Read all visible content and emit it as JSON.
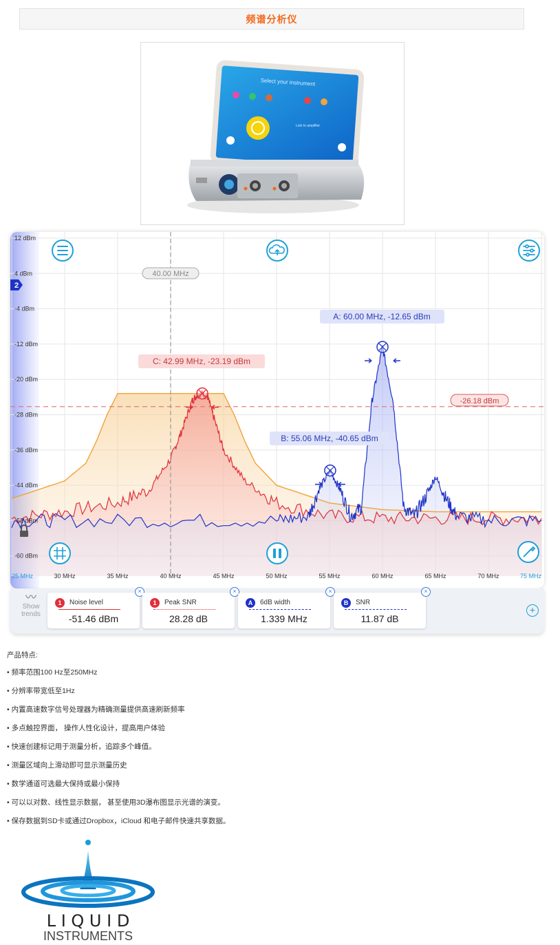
{
  "page_title": "频谱分析仪",
  "product_screen": {
    "heading": "Select your instrument",
    "center_label": "Link to amplifier"
  },
  "analyzer": {
    "y_ticks": [
      "12 dBm",
      "4 dBm",
      "-4 dBm",
      "-12 dBm",
      "-20 dBm",
      "-28 dBm",
      "-36 dBm",
      "-44 dBm",
      "-52 dBm",
      "-60 dBm"
    ],
    "x_ticks": [
      "25 MHz",
      "30 MHz",
      "35 MHz",
      "40 MHz",
      "45 MHz",
      "50 MHz",
      "55 MHz",
      "60 MHz",
      "65 MHz",
      "70 MHz",
      "75 MHz"
    ],
    "cursor_label": "40.00 MHz",
    "threshold_label": "-26.18 dBm",
    "channel_badge": "2",
    "markers": {
      "A": "A: 60.00 MHz, -12.65 dBm",
      "B": "B: 55.06 MHz, -40.65 dBm",
      "C": "C: 42.99 MHz, -23.19 dBm"
    },
    "colors": {
      "red": "#e0303a",
      "blue": "#1f33c6",
      "orange": "#f0a33a",
      "accent": "#1ea0d8"
    }
  },
  "chart_data": {
    "type": "line",
    "xlabel": "",
    "ylabel": "",
    "xlim": [
      25,
      75
    ],
    "ylim": [
      -64,
      12
    ],
    "x_ticks": [
      25,
      30,
      35,
      40,
      45,
      50,
      55,
      60,
      65,
      70,
      75
    ],
    "y_ticks": [
      12,
      4,
      -4,
      -12,
      -20,
      -28,
      -36,
      -44,
      -52,
      -60
    ],
    "series": [
      {
        "color": "#e0303a",
        "x": [
          25,
          30,
          35,
          38,
          40,
          41,
          42,
          42.5,
          42.99,
          43.5,
          44,
          45,
          47,
          50,
          55,
          60,
          65,
          70,
          75
        ],
        "y": [
          -51.5,
          -50,
          -48,
          -45,
          -38,
          -32,
          -25,
          -23.5,
          -23.19,
          -24,
          -28,
          -36,
          -43,
          -48,
          -51,
          -51.5,
          -51.5,
          -51.5,
          -51.5
        ]
      },
      {
        "color": "#1f33c6",
        "x": [
          25,
          30,
          40,
          50,
          53,
          54,
          55.06,
          56,
          57,
          58,
          59,
          60,
          61,
          62,
          63,
          64,
          65,
          66,
          67,
          70,
          75
        ],
        "y": [
          -52,
          -52,
          -52,
          -52,
          -51,
          -45,
          -40.65,
          -45,
          -51,
          -49,
          -25,
          -12.65,
          -25,
          -49,
          -51,
          -47,
          -42,
          -47,
          -51,
          -52,
          -52
        ]
      },
      {
        "color": "#f0a33a",
        "x": [
          25,
          30,
          32,
          33,
          34,
          35,
          36,
          37,
          38,
          40,
          42,
          43,
          44,
          45,
          46,
          47,
          48,
          50,
          55,
          60,
          65,
          70,
          75
        ],
        "y": [
          -47,
          -43,
          -39,
          -34,
          -28,
          -23.2,
          -23.2,
          -23.2,
          -23.2,
          -23.2,
          -23.2,
          -23.2,
          -23.2,
          -23.2,
          -28,
          -34,
          -39,
          -44,
          -48,
          -49.5,
          -50,
          -50,
          -50
        ]
      }
    ]
  },
  "measurements": {
    "show_trends": "Show trends",
    "cards": [
      {
        "badge": "1",
        "label": "Noise level",
        "value": "-51.46 dBm",
        "color": "#e0303a"
      },
      {
        "badge": "1",
        "label": "Peak SNR",
        "value": "28.28 dB",
        "color": "#e0303a"
      },
      {
        "badge": "A",
        "label": "6dB width",
        "value": "1.339 MHz",
        "color": "#1f33c6"
      },
      {
        "badge": "B",
        "label": "SNR",
        "value": "11.87 dB",
        "color": "#1f33c6"
      }
    ]
  },
  "features": {
    "heading": "产品特点:",
    "items": [
      "频率范围100 Hz至250MHz",
      "分辨率带宽低至1Hz",
      "内置高速数字信号处理器为精确测量提供高速刷新频率",
      "多点触控界面， 操作人性化设计，提高用户体验",
      "快速创建标记用于测量分析，追踪多个峰值。",
      "测量区域向上滑动即可显示测量历史",
      "数学通道可选最大保持或最小保持",
      "可以以对数、线性显示数据， 甚至使用3D瀑布图显示光谱的演变。",
      "保存数据到SD卡或通过Dropbox，iCloud 和电子邮件快速共享数据。"
    ]
  },
  "logo": {
    "line1": "L I Q U I D",
    "line2": "INSTRUMENTS"
  }
}
